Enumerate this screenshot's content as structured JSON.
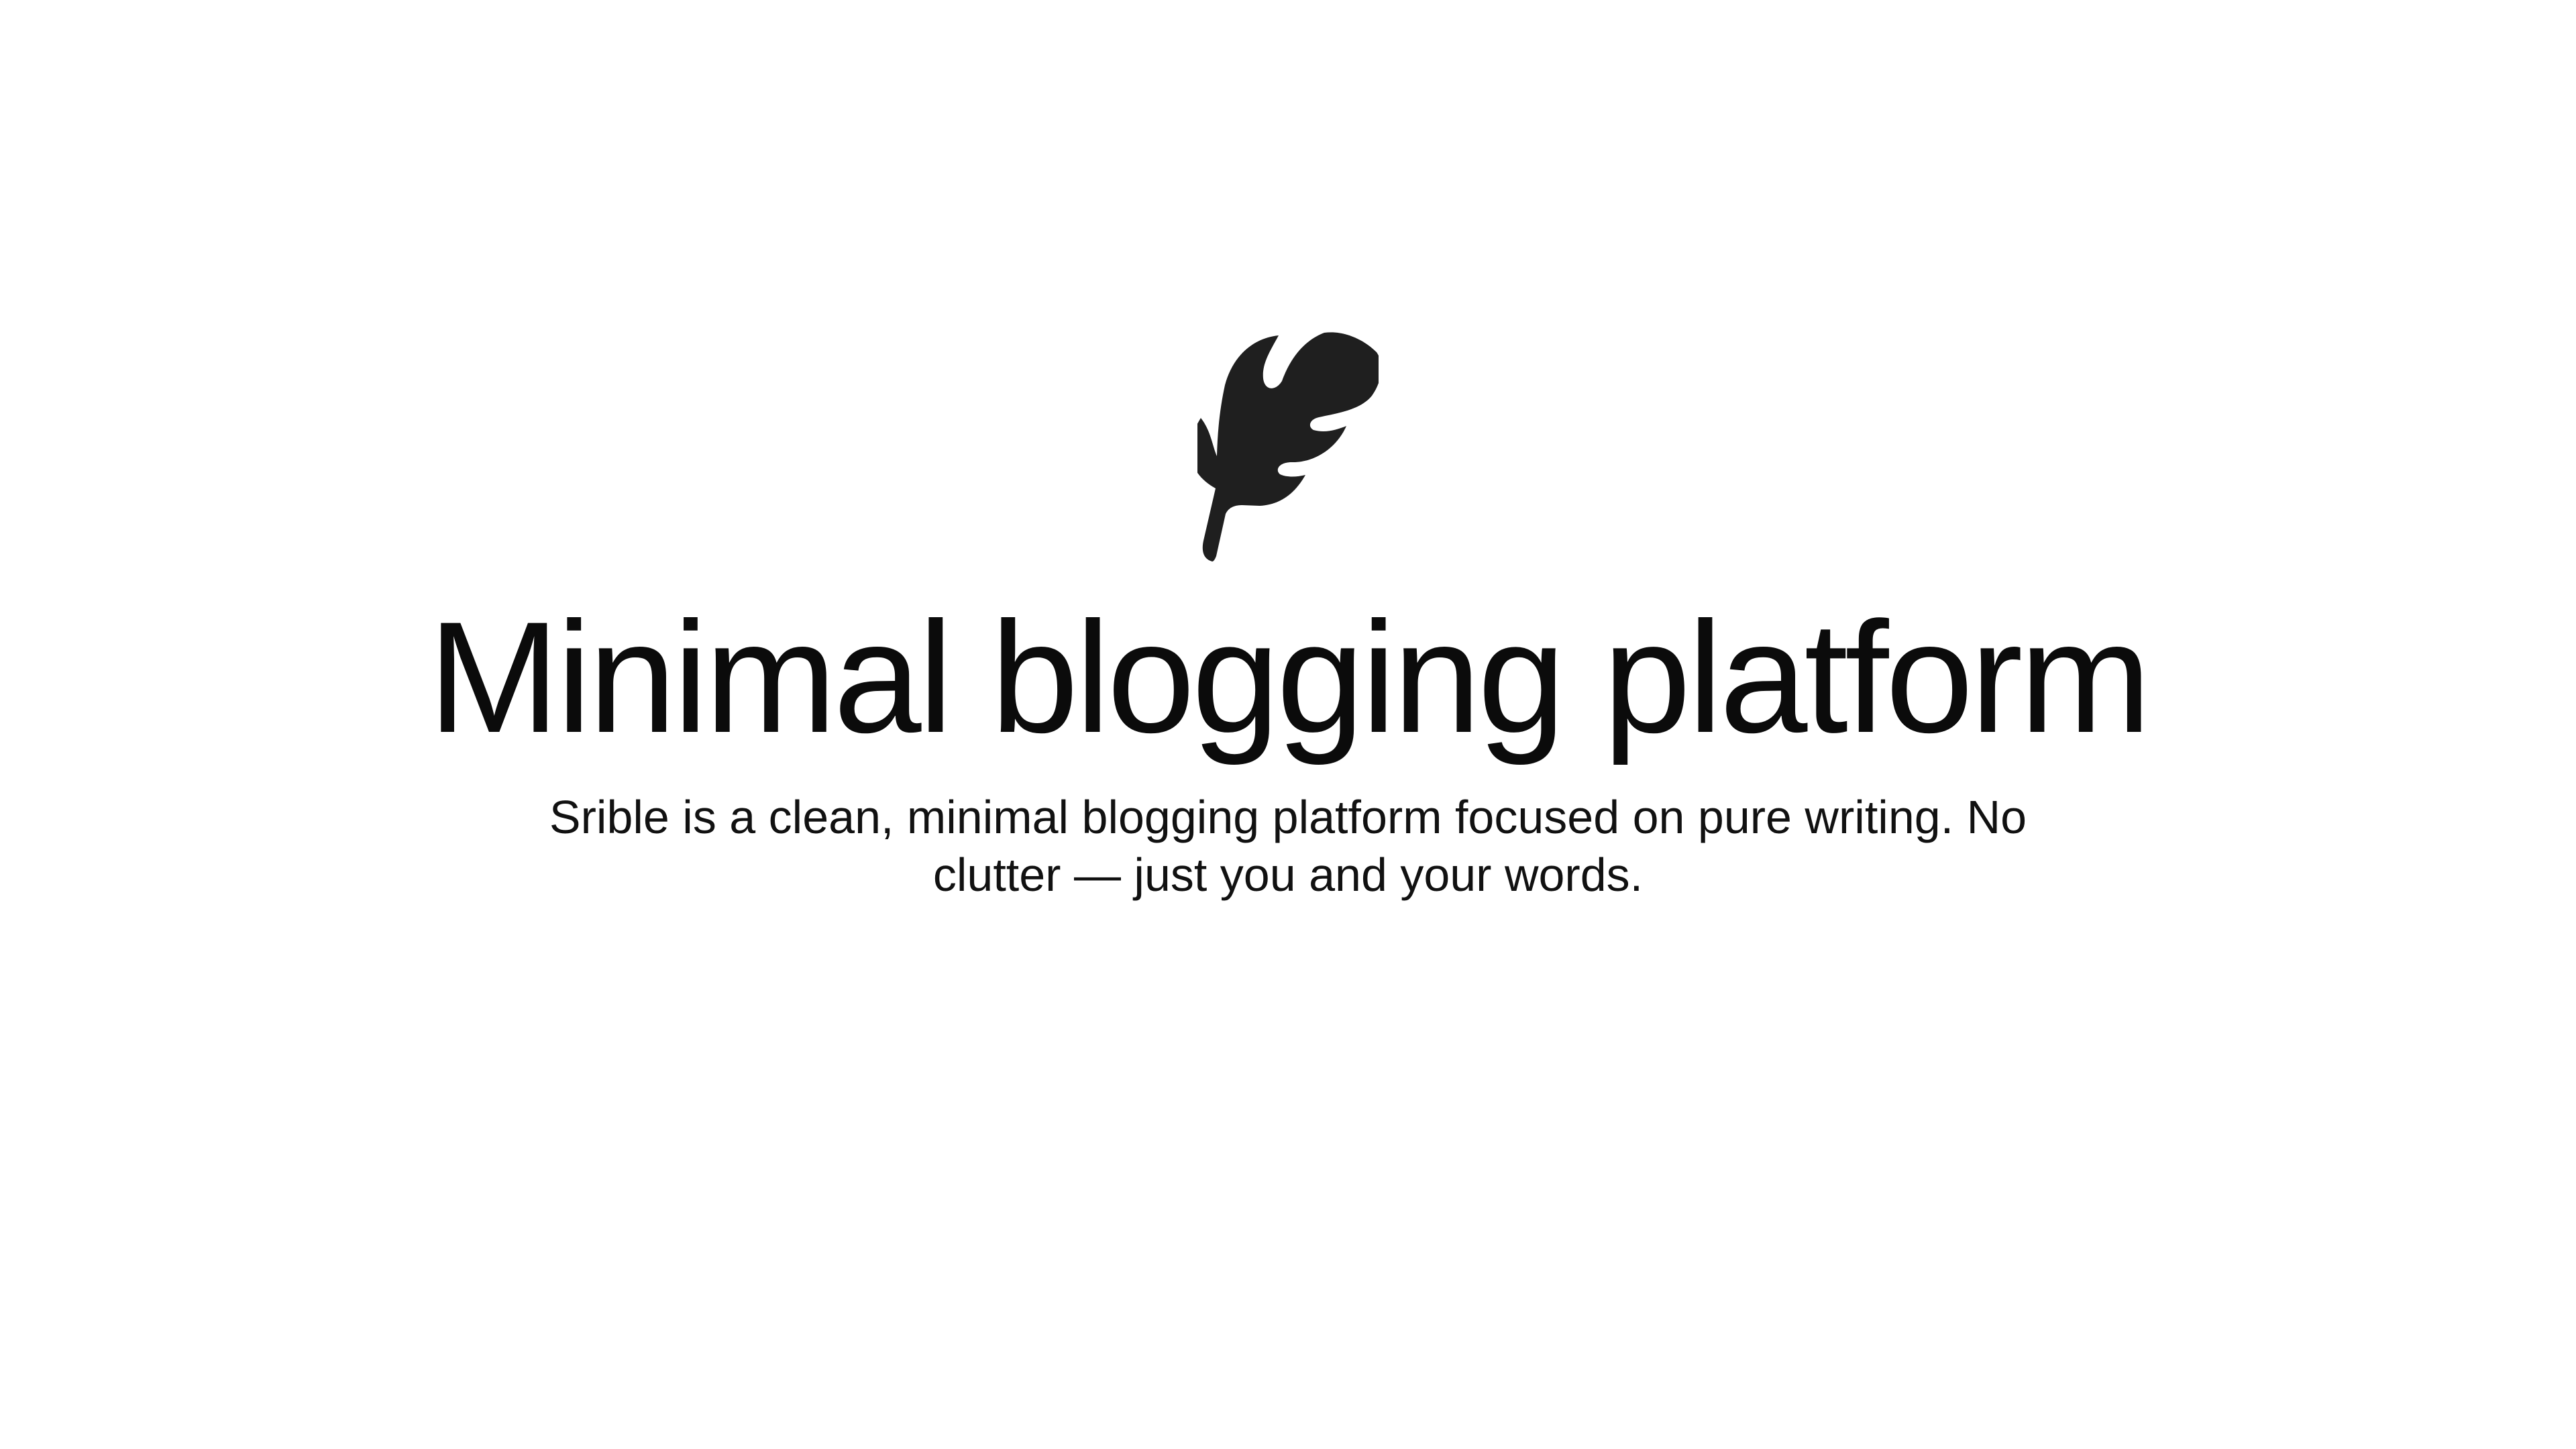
{
  "hero": {
    "logo_icon": "feather-icon",
    "title": "Minimal blogging platform",
    "description": "Srible is a clean, minimal blogging platform focused on pure writing. No clutter — just you and your words."
  },
  "colors": {
    "background": "#ffffff",
    "text": "#111111",
    "icon": "#1f1f1f"
  }
}
